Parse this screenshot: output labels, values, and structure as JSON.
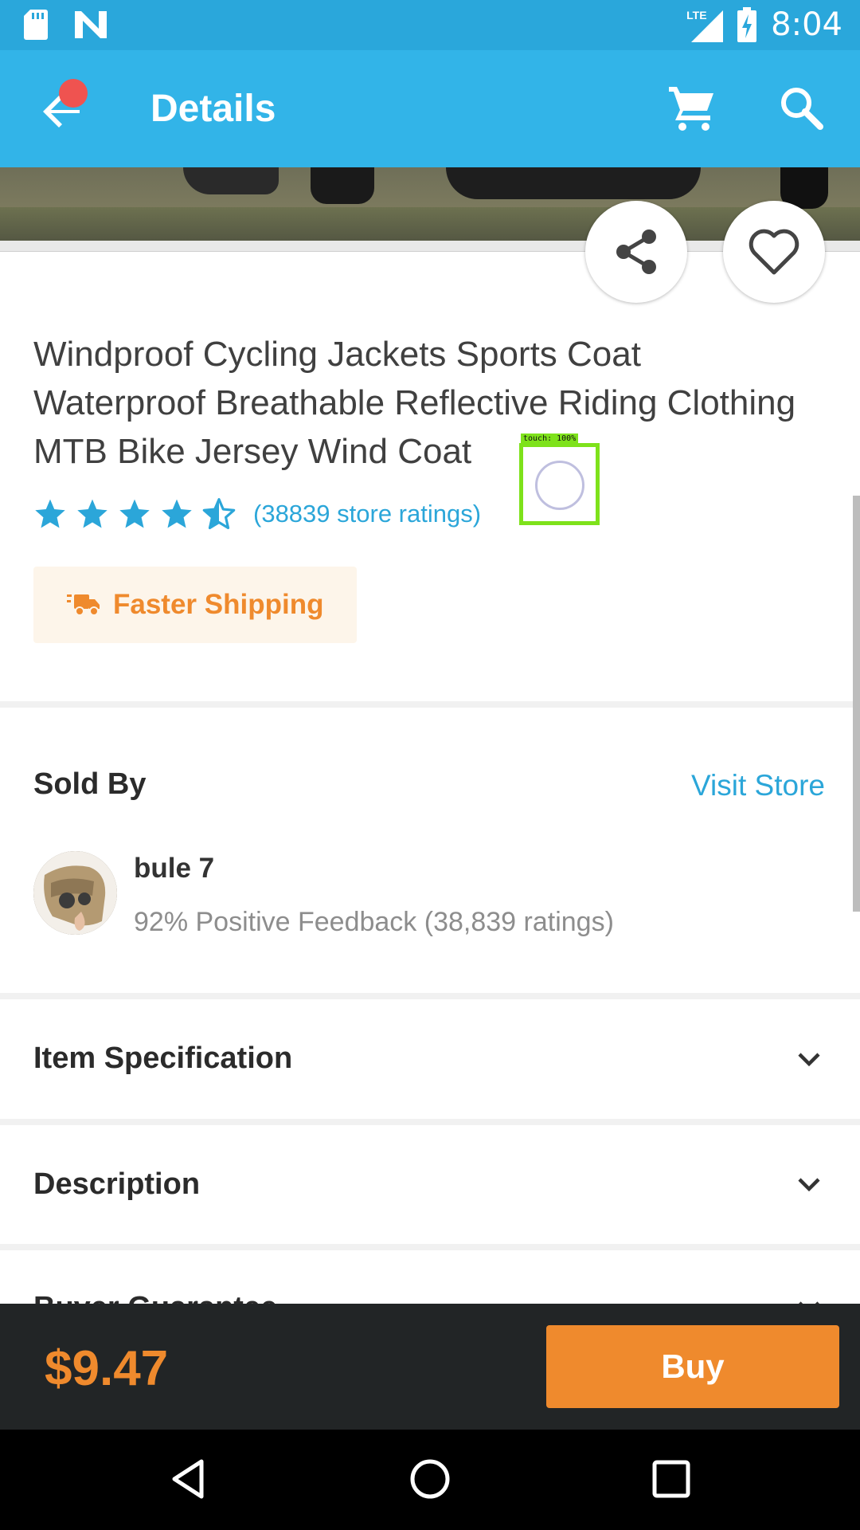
{
  "status_bar": {
    "time": "8:04",
    "network_label": "LTE",
    "icons": [
      "sd-card-icon",
      "n-notification-icon",
      "lte-signal-icon",
      "battery-charging-icon"
    ]
  },
  "app_bar": {
    "title": "Details",
    "icons": [
      "back-arrow-icon",
      "cart-icon",
      "search-icon"
    ]
  },
  "product": {
    "title": "Windproof Cycling Jackets Sports Coat Waterproof Breathable Reflective Riding Clothing MTB Bike Jersey Wind Coat",
    "rating": 4.5,
    "rating_count": "(38839 store ratings)",
    "shipping_badge": "Faster Shipping"
  },
  "seller": {
    "heading": "Sold By",
    "visit_store": "Visit Store",
    "name": "bule 7",
    "feedback": "92% Positive Feedback (38,839 ratings)"
  },
  "sections": [
    {
      "title": "Item Specification"
    },
    {
      "title": "Description"
    },
    {
      "title": "Buyer Guarantee"
    }
  ],
  "purchase": {
    "price": "$9.47",
    "buy_label": "Buy"
  },
  "touch_overlay": {
    "label": "touch: 100%"
  },
  "colors": {
    "status_bar": "#2aa7db",
    "app_bar": "#32b4e8",
    "accent": "#2ba6d9",
    "orange": "#ef8a2d",
    "buy_bar": "#222526"
  }
}
